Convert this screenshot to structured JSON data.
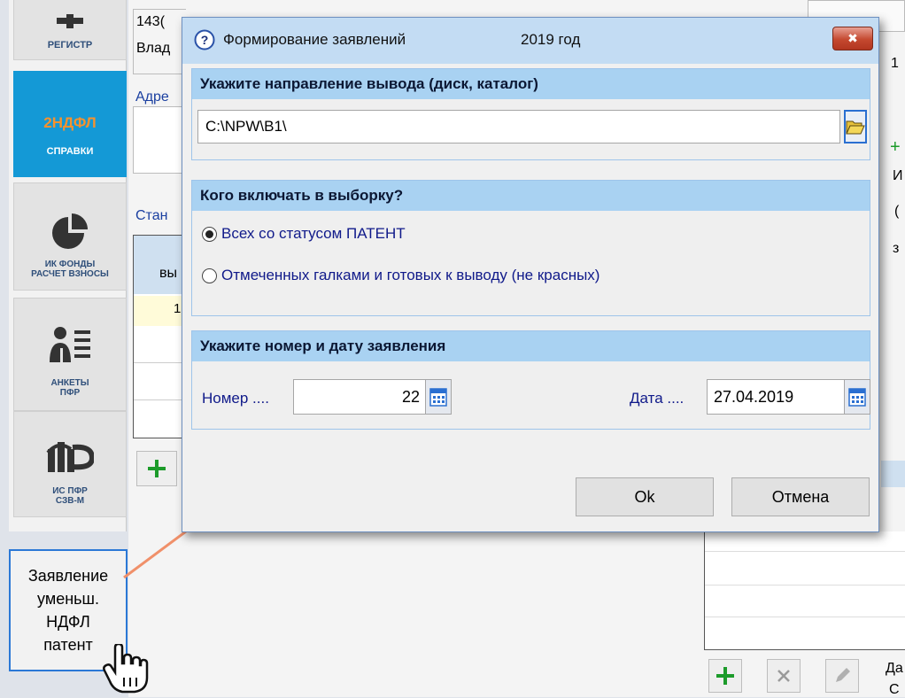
{
  "sidebar": {
    "items": [
      {
        "label": "РЕГИСТР",
        "icon": "plus-icon"
      },
      {
        "title": "2НДФЛ",
        "label": "СПРАВКИ",
        "icon": "none"
      },
      {
        "label": "ИК ФОНДЫ\nРАСЧЕТ ВЗНОСЫ",
        "icon": "pie-chart-icon"
      },
      {
        "label": "АНКЕТЫ\nПФР",
        "icon": "person-list-icon"
      },
      {
        "label": "ИС ПФР\nСЗВ-М",
        "icon": "pfr-logo-icon"
      }
    ],
    "active_title_color": "#f7922d",
    "active_bg": "#1499d6"
  },
  "background": {
    "top_value_1": "143(",
    "top_value_2": "Влад",
    "address_label": "Адре",
    "station_label": "Стан",
    "column_header": "вы",
    "row_value": "1",
    "side_chars": [
      "1",
      "+",
      "И",
      "(",
      "з"
    ],
    "bottom_right_label_1": "Да",
    "bottom_right_label_2": "С"
  },
  "feature_button": {
    "label": "Заявление\nуменьш.\nНДФЛ\nпатент"
  },
  "dialog": {
    "title": "Формирование заявлений",
    "year": "2019 год",
    "close_symbol": "✖",
    "output": {
      "header": "Укажите направление вывода (диск, каталог)",
      "path": "C:\\NPW\\B1\\"
    },
    "selection": {
      "header": "Кого включать в выборку?",
      "options": [
        {
          "label": "Всех со статусом ПАТЕНТ",
          "selected": true
        },
        {
          "label": "Отмеченных галками и готовых к выводу (не красных)",
          "selected": false
        }
      ]
    },
    "number_date": {
      "header": "Укажите номер и дату заявления",
      "number_label": "Номер ....",
      "number_value": "22",
      "date_label": "Дата ....",
      "date_value": "27.04.2019"
    },
    "ok_label": "Ok",
    "cancel_label": "Отмена"
  },
  "colors": {
    "section_header": "#a9d2f2",
    "titlebar": "#c3dcf3",
    "arrow": "#f0906a",
    "highlight_border": "#2b78d6",
    "label_text": "#101a8a"
  }
}
